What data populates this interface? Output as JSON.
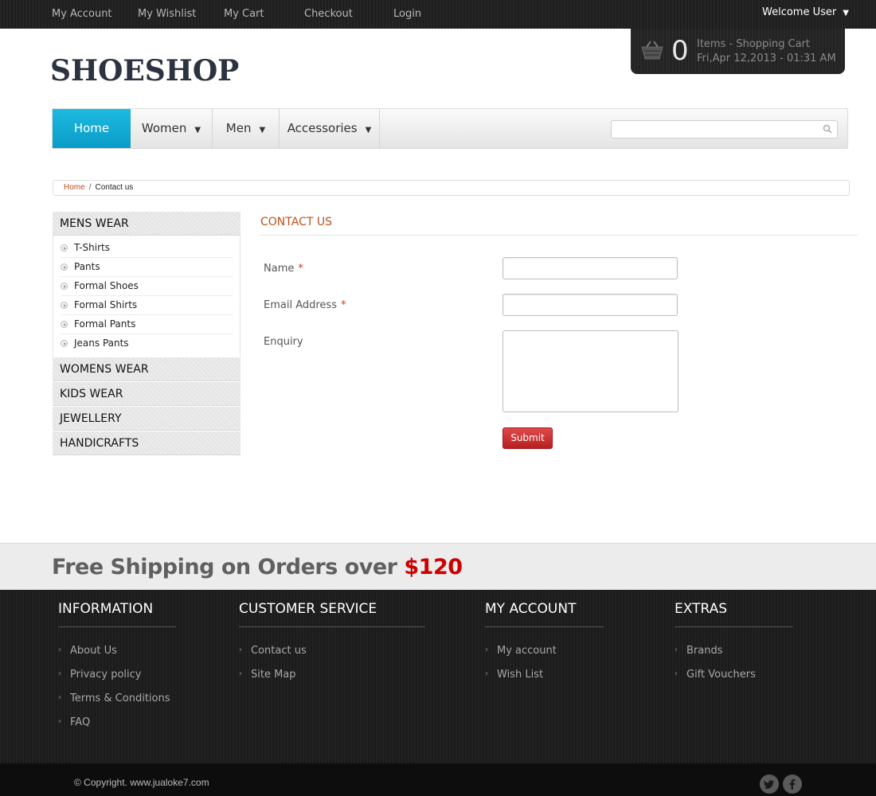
{
  "topbar": {
    "links": [
      "My Account",
      "My Wishlist",
      "My Cart",
      "Checkout",
      "Login"
    ],
    "welcome": "Welcome User"
  },
  "logo": "SHOESHOP",
  "cart": {
    "count": "0",
    "line1": "Items - Shopping Cart",
    "line2": "Fri,Apr 12,2013 - 01:31 AM"
  },
  "nav": {
    "items": [
      "Home",
      "Women",
      "Men",
      "Accessories"
    ],
    "search_placeholder": ""
  },
  "breadcrumb": {
    "home": "Home",
    "separator": "/",
    "current": "Contact us"
  },
  "sidebar": {
    "sections": [
      "MENS WEAR",
      "WOMENS WEAR",
      "KIDS WEAR",
      "JEWELLERY",
      "HANDICRAFTS"
    ],
    "mens_items": [
      "T-Shirts",
      "Pants",
      "Formal Shoes",
      "Formal Shirts",
      "Formal Pants",
      "Jeans Pants"
    ]
  },
  "contact": {
    "title": "CONTACT US",
    "name_label": "Name",
    "email_label": "Email Address",
    "enquiry_label": "Enquiry",
    "required_mark": "*",
    "submit": "Submit"
  },
  "shipping": {
    "text": "Free Shipping on Orders over ",
    "price": "$120"
  },
  "footer": {
    "columns": [
      {
        "title": "INFORMATION",
        "links": [
          "About Us",
          "Privacy policy",
          "Terms & Conditions",
          "FAQ"
        ]
      },
      {
        "title": "CUSTOMER SERVICE",
        "links": [
          "Contact us",
          "Site Map"
        ]
      },
      {
        "title": "MY ACCOUNT",
        "links": [
          "My account",
          "Wish List"
        ]
      },
      {
        "title": "EXTRAS",
        "links": [
          "Brands",
          "Gift Vouchers"
        ]
      }
    ],
    "copyright": "© Copyright. www.jualoke7.com",
    "social": {
      "twitter": "twitter-icon",
      "facebook": "facebook-icon"
    }
  },
  "colors": {
    "accent": "#0fa8d4",
    "title_orange": "#c0501a",
    "submit_red": "#c62828",
    "price_red": "#cc0000"
  }
}
